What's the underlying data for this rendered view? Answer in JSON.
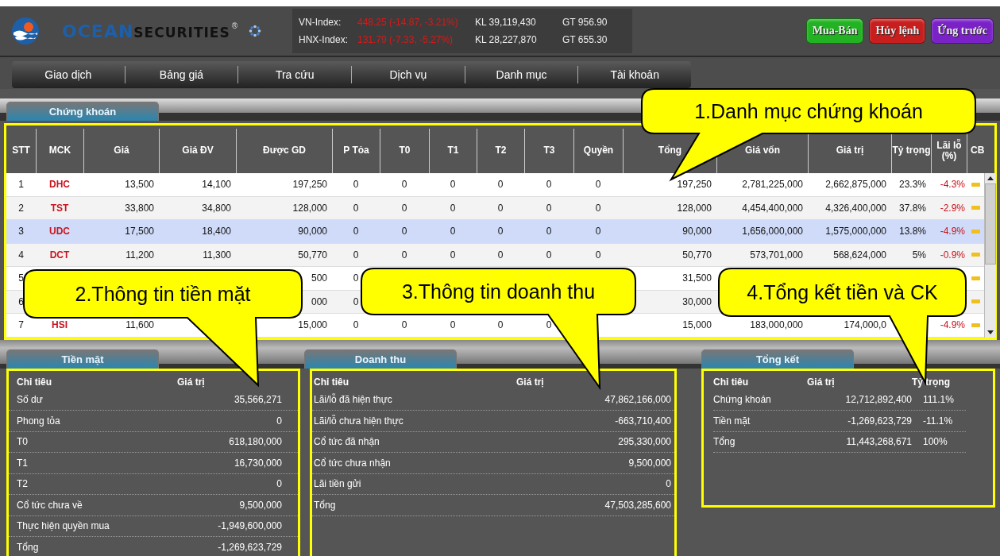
{
  "brand": {
    "name_parts": [
      "OCEAN",
      "SECURITIES"
    ],
    "mark": "®"
  },
  "indices": [
    {
      "name": "VN-Index:",
      "value": "448.25 (-14.87, -3.21%)",
      "volume": "KL 39,119,430",
      "turnover": "GT 956.90"
    },
    {
      "name": "HNX-Index:",
      "value": "131.79 (-7.33, -5.27%)",
      "volume": "KL 28,227,870",
      "turnover": "GT 655.30"
    }
  ],
  "action_buttons": [
    {
      "label": "Mua-Bán",
      "color": "#22b322"
    },
    {
      "label": "Hủy lệnh",
      "color": "#c81e1e"
    },
    {
      "label": "Ứng trước",
      "color": "#7a22c8"
    }
  ],
  "menu": [
    "Giao dịch",
    "Bảng giá",
    "Tra cứu",
    "Dịch vụ",
    "Danh mục",
    "Tài khoản"
  ],
  "portfolio": {
    "tab": "Chứng khoán",
    "highlighted": true,
    "columns": [
      {
        "label": "STT",
        "kind": "index"
      },
      {
        "label": "MCK",
        "kind": "code"
      },
      {
        "label": "Giá",
        "kind": "number"
      },
      {
        "label": "Giá ĐV",
        "kind": "number"
      },
      {
        "label": "Được GD",
        "kind": "number"
      },
      {
        "label": "P Tỏa",
        "kind": "count"
      },
      {
        "label": "T0",
        "kind": "count"
      },
      {
        "label": "T1",
        "kind": "count"
      },
      {
        "label": "T2",
        "kind": "count"
      },
      {
        "label": "T3",
        "kind": "count"
      },
      {
        "label": "Quyền",
        "kind": "count"
      },
      {
        "label": "Tổng",
        "kind": "number"
      },
      {
        "label": "Giá vốn",
        "kind": "number"
      },
      {
        "label": "Giá trị",
        "kind": "number"
      },
      {
        "label": "Tỷ trọng",
        "kind": "number"
      },
      {
        "label": "Lãi lỗ (%)",
        "kind": "change"
      },
      {
        "label": "CB",
        "kind": "flag"
      }
    ],
    "rows": [
      {
        "selected": false,
        "cells": [
          "1",
          "DHC",
          "13,500",
          "14,100",
          "197,250",
          "0",
          "0",
          "0",
          "0",
          "0",
          "0",
          "197,250",
          "2,781,225,000",
          "2,662,875,000",
          "23.3%",
          "-4.3%"
        ]
      },
      {
        "selected": false,
        "cells": [
          "2",
          "TST",
          "33,800",
          "34,800",
          "128,000",
          "0",
          "0",
          "0",
          "0",
          "0",
          "0",
          "128,000",
          "4,454,400,000",
          "4,326,400,000",
          "37.8%",
          "-2.9%"
        ]
      },
      {
        "selected": true,
        "cells": [
          "3",
          "UDC",
          "17,500",
          "18,400",
          "90,000",
          "0",
          "0",
          "0",
          "0",
          "0",
          "0",
          "90,000",
          "1,656,000,000",
          "1,575,000,000",
          "13.8%",
          "-4.9%"
        ]
      },
      {
        "selected": false,
        "cells": [
          "4",
          "DCT",
          "11,200",
          "11,300",
          "50,770",
          "0",
          "0",
          "0",
          "0",
          "0",
          "0",
          "50,770",
          "573,701,000",
          "568,624,000",
          "5%",
          "-0.9%"
        ]
      },
      {
        "selected": false,
        "cells": [
          "5",
          null,
          null,
          null,
          "500",
          "0",
          null,
          null,
          null,
          null,
          null,
          "31,500",
          null,
          null,
          null,
          null
        ]
      },
      {
        "selected": false,
        "cells": [
          "6",
          null,
          null,
          null,
          "000",
          "0",
          null,
          null,
          null,
          null,
          null,
          "30,000",
          null,
          null,
          null,
          null
        ]
      },
      {
        "selected": false,
        "cells": [
          "7",
          "HSI",
          "11,600",
          null,
          "15,000",
          "0",
          "0",
          "0",
          "0",
          "0",
          null,
          "15,000",
          "183,000,000",
          "174,000,0",
          null,
          "-4.9%"
        ]
      }
    ]
  },
  "cash": {
    "tab": "Tiền mặt",
    "highlighted": true,
    "headers": [
      "Chỉ tiêu",
      "Giá trị"
    ],
    "rows": [
      {
        "label": "Số dư",
        "value": "35,566,271"
      },
      {
        "label": "Phong tỏa",
        "value": "0"
      },
      {
        "label": "T0",
        "value": "618,180,000"
      },
      {
        "label": "T1",
        "value": "16,730,000"
      },
      {
        "label": "T2",
        "value": "0"
      },
      {
        "label": "Cổ tức chưa về",
        "value": "9,500,000"
      },
      {
        "label": "Thực hiện quyền mua",
        "value": "-1,949,600,000"
      },
      {
        "label": "Tổng",
        "value": "-1,269,623,729"
      }
    ]
  },
  "revenue": {
    "tab": "Doanh thu",
    "highlighted": true,
    "headers": [
      "Chỉ tiêu",
      "Giá trị"
    ],
    "rows": [
      {
        "label": "Lãi/lỗ đã hiện thực",
        "value": "47,862,166,000"
      },
      {
        "label": "Lãi/lỗ chưa hiện thực",
        "value": "-663,710,400"
      },
      {
        "label": "Cổ tức đã nhận",
        "value": "295,330,000"
      },
      {
        "label": "Cổ tức chưa nhận",
        "value": "9,500,000"
      },
      {
        "label": "Lãi tiền gửi",
        "value": "0"
      },
      {
        "label": "Tổng",
        "value": "47,503,285,600"
      }
    ]
  },
  "summary": {
    "tab": "Tổng kết",
    "highlighted": true,
    "headers": [
      "Chỉ tiêu",
      "Giá trị",
      "Tỷ trọng"
    ],
    "rows": [
      {
        "label": "Chứng khoán",
        "value": "12,712,892,400",
        "share": "111.1%"
      },
      {
        "label": "Tiền mặt",
        "value": "-1,269,623,729",
        "share": "-11.1%"
      },
      {
        "label": "Tổng",
        "value": "11,443,268,671",
        "share": "100%"
      }
    ]
  },
  "callouts": [
    "1.Danh mục chứng khoán",
    "2.Thông tin tiền mặt",
    "3.Thông tin doanh thu",
    "4.Tổng kết tiền và CK"
  ]
}
